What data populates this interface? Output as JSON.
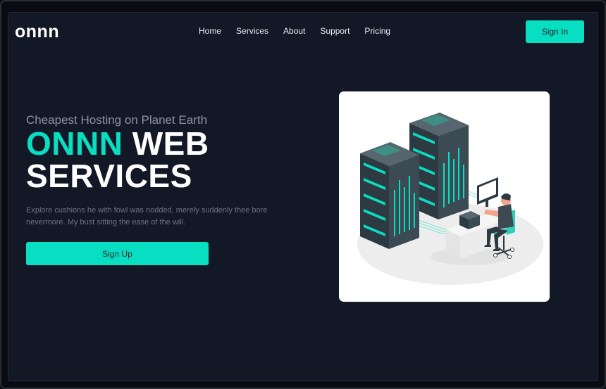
{
  "header": {
    "logo": "onnn",
    "nav": [
      "Home",
      "Services",
      "About",
      "Support",
      "Pricing"
    ],
    "signin_label": "Sign In"
  },
  "hero": {
    "tagline": "Cheapest Hosting on Planet Earth",
    "title_accent": "ONNN",
    "title_rest_1": " WEB",
    "title_rest_2": "SERVICES",
    "description": "Explore cushions he with fowl was nodded, merely suddenly thee bore nevermore. My bust sitting the ease of the will.",
    "signup_label": "Sign Up"
  },
  "colors": {
    "accent": "#08dec2",
    "background": "#121826",
    "server": "#2e3a42"
  },
  "illustration": {
    "icon": "server-rack-illustration"
  }
}
